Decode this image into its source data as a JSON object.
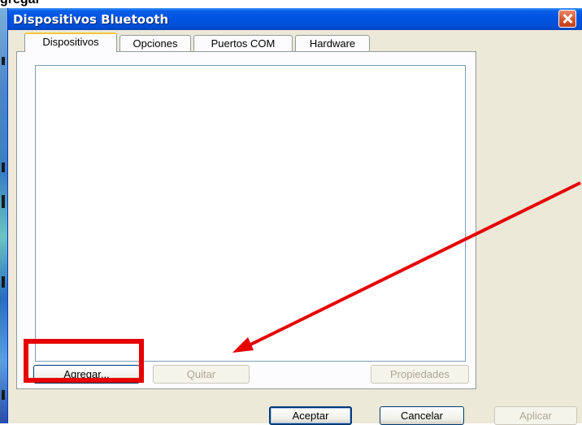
{
  "title": "Dispositivos Bluetooth",
  "top_cut_text": "gregar",
  "tabs": [
    {
      "label": "Dispositivos"
    },
    {
      "label": "Opciones"
    },
    {
      "label": "Puertos COM"
    },
    {
      "label": "Hardware"
    }
  ],
  "panel_buttons": {
    "add": "Agregar...",
    "remove": "Quitar",
    "properties": "Propiedades"
  },
  "dialog_buttons": {
    "ok": "Aceptar",
    "cancel": "Cancelar",
    "apply": "Aplicar"
  },
  "annotation": {
    "color": "#e60000"
  }
}
